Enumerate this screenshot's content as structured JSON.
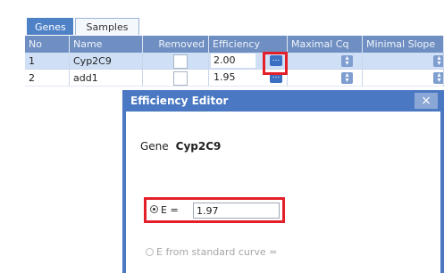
{
  "tabs": [
    "Genes",
    "Samples"
  ],
  "grid": {
    "headers": {
      "no": "No",
      "name": "Name",
      "removed": "Removed",
      "efficiency": "Efficiency",
      "maximal_cq": "Maximal Cq",
      "minimal_slope": "Minimal Slope"
    },
    "rows": [
      {
        "no": "1",
        "name": "Cyp2C9",
        "efficiency": "2.00"
      },
      {
        "no": "2",
        "name": "add1",
        "efficiency": "1.95"
      }
    ],
    "ellipsis_label": "..."
  },
  "dialog": {
    "title": "Efficiency Editor",
    "close_label": "×",
    "gene_label": "Gene",
    "gene_value": "Cyp2C9",
    "e_label": "E =",
    "e_value": "1.97",
    "std_curve_label": "E from standard curve ="
  },
  "colors": {
    "accent": "#4a78c2",
    "highlight": "#e3202a",
    "selected_row": "#cfe0f6"
  }
}
